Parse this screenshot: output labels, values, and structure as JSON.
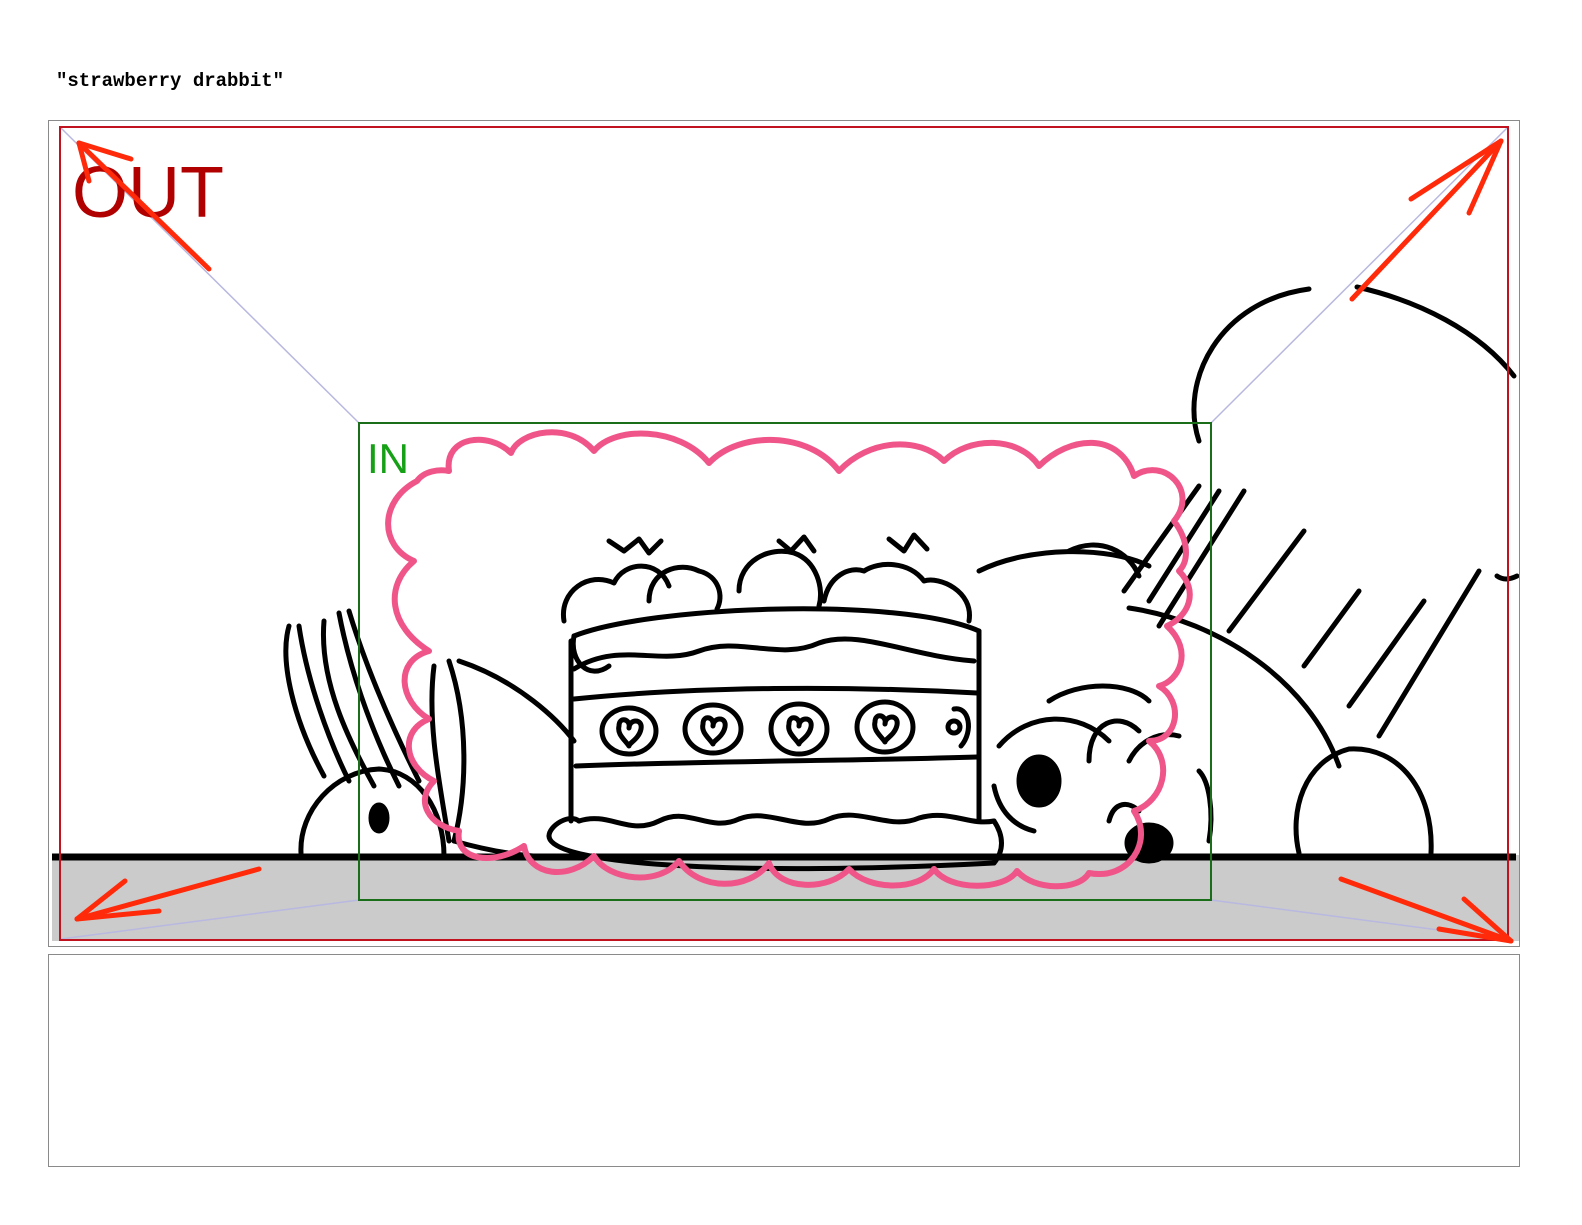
{
  "page": {
    "title": "\"strawberry drabbit\""
  },
  "panel": {
    "out_label": "OUT",
    "in_label": "IN"
  },
  "colors": {
    "out_frame": "#c0121f",
    "out_label": "#b00000",
    "in_frame": "#1a6e1a",
    "in_label": "#15a015",
    "move_arrows": "#ff2a0a",
    "guide_lines": "#b8b8e0",
    "cloud_outline": "#f0558a",
    "floor_fill": "#cbcbcb",
    "ink": "#000000"
  },
  "icons": {
    "move_arrows": [
      "arrow-up-left-icon",
      "arrow-up-right-icon",
      "arrow-down-left-icon",
      "arrow-down-right-icon"
    ]
  }
}
